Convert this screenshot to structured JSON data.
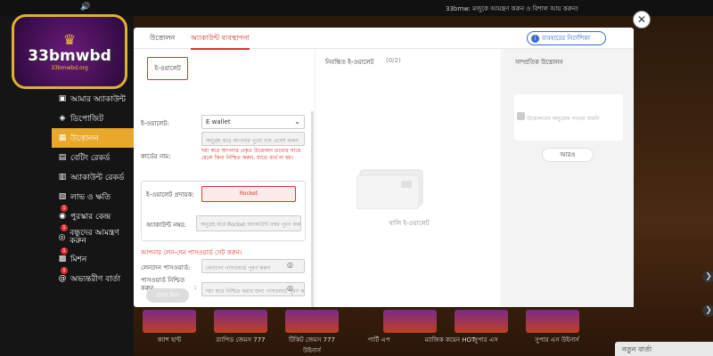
{
  "topbar": {
    "marquee": "33bmw: মজুকে আমন্ত্রণ করুন ও বিশাল আয় করুন!"
  },
  "logo": {
    "name": "33bmwbd",
    "sub": "33bmwbd.org"
  },
  "sidebar": {
    "items": [
      {
        "label": "আমার অ্যাকাউন্ট",
        "icon": "user-icon"
      },
      {
        "label": "ডিপোজিট",
        "icon": "deposit-icon"
      },
      {
        "label": "উত্তোলন",
        "icon": "withdraw-icon",
        "active": true
      },
      {
        "label": "বেটিং রেকর্ড",
        "icon": "betting-record-icon"
      },
      {
        "label": "অ্যাকাউন্ট রেকর্ড",
        "icon": "account-record-icon"
      },
      {
        "label": "লাভ ও ক্ষতি",
        "icon": "profit-loss-icon"
      },
      {
        "label": "পুরস্কার কেন্দ্র",
        "icon": "reward-icon",
        "badge": "1"
      },
      {
        "label": "বন্ধুদের আমন্ত্রণ করুন",
        "icon": "invite-icon",
        "badge": "1"
      },
      {
        "label": "মিশন",
        "icon": "mission-icon",
        "badge": "1"
      },
      {
        "label": "অভ্যন্তরীণ বার্তা",
        "icon": "message-icon",
        "badge": "1"
      }
    ]
  },
  "games": [
    {
      "label": "ক্যাশ হান্ট"
    },
    {
      "label": "র‍্যাপিড জেমস 777"
    },
    {
      "label": "টিকিট জেমস 777 উইনার্স"
    },
    {
      "label": "পার্টি এপ"
    },
    {
      "label": "ম্যাজিক কয়েন HOT"
    },
    {
      "label": "সুপার এস"
    },
    {
      "label": "সুপার এস উইনার্স"
    }
  ],
  "news_label": "নতুন বার্তা",
  "modal": {
    "tabs": [
      "উত্তোলন",
      "অ্যাকাউন্ট ব্যবস্থাপনা"
    ],
    "guide_label": "ব্যবহারের নির্দেশিকা",
    "ewallet_chip": "ই-ওয়ালেট",
    "ewallet_label": "ই-ওয়ালেট:",
    "ewallet_value": "E wallet",
    "cardname_label": "কার্ডের নাম:",
    "cardname_placeholder": "অনুগ্রহ করে আপনার পুরো নাম প্রবেশ করুন",
    "warning": "দয়া করে আপনার প্রকৃত উত্তোলন তথ্যের সাথে মেলে কিনা নিশ্চিত করুন, যাতে ব্যর্থ না হয়।",
    "provider_label": "ই-ওয়ালেট প্রদায়ক:",
    "provider_value": "Rocket",
    "account_label": "অ্যাকাউন্ট নম্বর:",
    "account_placeholder": "অনুগ্রহ করে Rocket অ্যাকাউন্ট নম্বর পূরণ করুন",
    "pwd_header": "আপনার লেন-দেন পাসওয়ার্ড সেট করুন।",
    "pwd_label": "লেনদেন পাসওয়ার্ড:",
    "pwd_placeholder": "লেনদেন পাসওয়ার্ড পূরণ করুন",
    "pwd_confirm_label": "পাসওয়ার্ড নিশ্চিত করুন",
    "pwd_confirm_placeholder": "দয়া করে নিশ্চিত করার জন্য পাসওয়ার্ড পূরণ করুন",
    "submit_label": "জমা দিন",
    "saved_title": "নিবন্ধিত ই-ওয়ালেট",
    "saved_count": "(0/2)",
    "empty_text": "খালি ই-ওয়ালেট",
    "recent_title": "সাম্প্রতিক উত্তোলন",
    "recent_empty": "উত্তোলনের অনুরোধ পাওয়া যায়নি",
    "more_label": "আরও"
  },
  "colors": {
    "accent": "#e8a82a",
    "danger": "#d33333",
    "link": "#3a6ad0"
  }
}
